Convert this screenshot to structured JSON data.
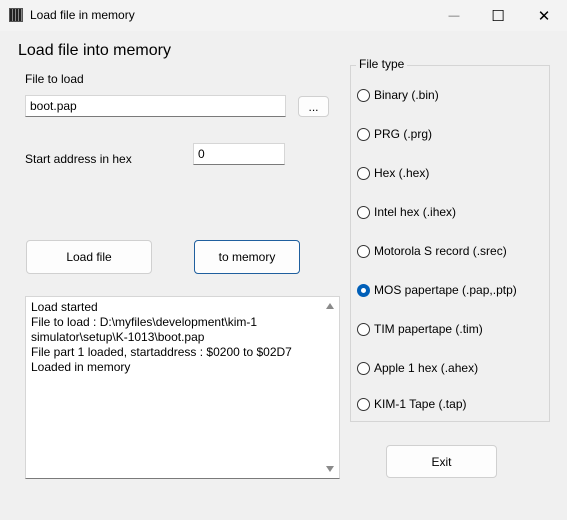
{
  "window": {
    "title": "Load file in memory",
    "minimize_glyph": "—",
    "maximize_glyph": "☐",
    "close_glyph": "✕"
  },
  "heading": "Load file into memory",
  "file": {
    "label": "File to load",
    "value": "boot.pap",
    "browse_label": "..."
  },
  "start_address": {
    "label": "Start address in hex",
    "value": "0"
  },
  "buttons": {
    "load_file": "Load file",
    "to_memory": "to memory",
    "exit": "Exit"
  },
  "log": {
    "lines": [
      "Load started",
      "File to load : D:\\myfiles\\development\\kim-1",
      "simulator\\setup\\K-1013\\boot.pap",
      "File part 1 loaded, startaddress : $0200 to $02D7",
      "Loaded in memory"
    ]
  },
  "file_type": {
    "title": "File type",
    "selected_index": 5,
    "options": [
      "Binary (.bin)",
      "PRG (.prg)",
      "Hex (.hex)",
      "Intel hex (.ihex)",
      "Motorola S record (.srec)",
      "MOS papertape (.pap,.ptp)",
      "TIM papertape (.tim)",
      "Apple 1 hex (.ahex)",
      "KIM-1 Tape (.tap)"
    ]
  },
  "colors": {
    "window_bg": "#f0f0f0",
    "accent": "#005fb8"
  }
}
